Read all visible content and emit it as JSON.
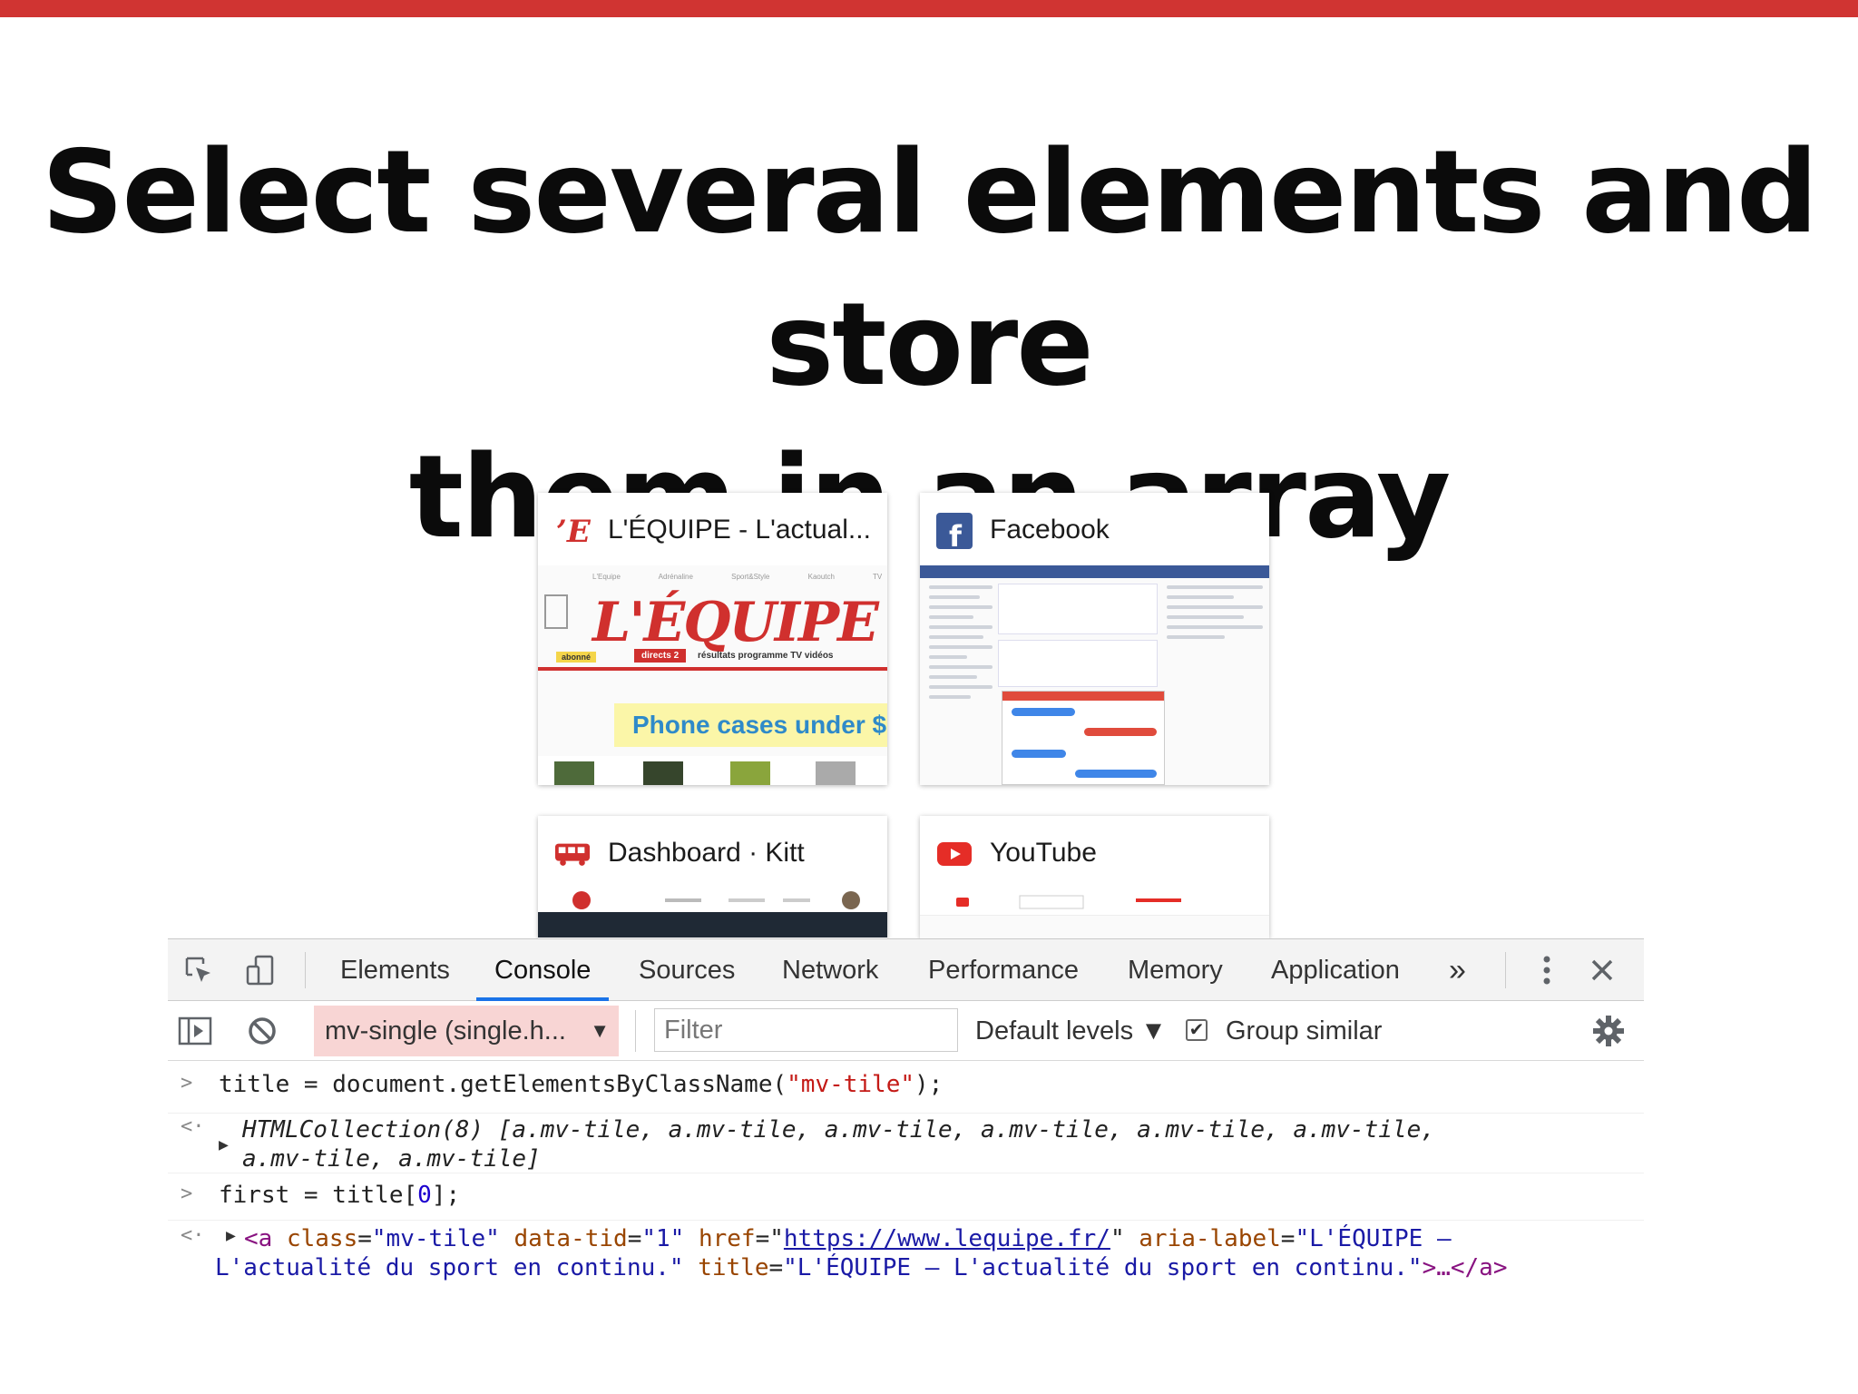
{
  "slide": {
    "title_line1": "Select several elements and store",
    "title_line2": "them in an array"
  },
  "tiles": [
    {
      "title": "L'ÉQUIPE - L'actual...",
      "favicon": "lequipe-icon"
    },
    {
      "title": "Facebook",
      "favicon": "facebook-icon"
    },
    {
      "title": "Dashboard · Kitt",
      "favicon": "bus-icon"
    },
    {
      "title": "YouTube",
      "favicon": "youtube-icon"
    }
  ],
  "thumbs": {
    "lequipe": {
      "logo": "L'ÉQUIPE",
      "abonne": "abonné",
      "directs": "directs",
      "directs_count": "2",
      "menu": "résultats  programme TV  vidéos",
      "banner": "Phone cases under $"
    }
  },
  "devtools": {
    "tabs": [
      "Elements",
      "Console",
      "Sources",
      "Network",
      "Performance",
      "Memory",
      "Application"
    ],
    "active_tab": "Console",
    "more": "»",
    "context": "mv-single (single.h...",
    "filter_placeholder": "Filter",
    "levels": "Default levels ▼",
    "group_similar": "Group similar",
    "group_checked": "✔"
  },
  "console": {
    "l1_code": "title = document.getElementsByClassName(",
    "l1_str": "\"mv-tile\"",
    "l1_end": ");",
    "l2_a": "HTMLCollection(8) [",
    "l2_items": "a.mv-tile, a.mv-tile, a.mv-tile, a.mv-tile, a.mv-tile, a.mv-tile,",
    "l2_b": "a.mv-tile, a.mv-tile]",
    "l3_code": "first = title[",
    "l3_num": "0",
    "l3_end": "];",
    "l4_open": "<a",
    "l4_class_attr": "class",
    "l4_class_val": "\"mv-tile\"",
    "l4_tid_attr": "data-tid",
    "l4_tid_val": "\"1\"",
    "l4_href_attr": "href",
    "l4_href_val": "https://www.lequipe.fr/",
    "l4_aria_attr": "aria-label",
    "l4_aria_val1": "\"L'ÉQUIPE –",
    "l4_aria_val2": "L'actualité du sport en continu.\"",
    "l4_title_attr": "title",
    "l4_title_val": "\"L'ÉQUIPE – L'actualité du sport en continu.\"",
    "l4_close": ">…</a>"
  }
}
